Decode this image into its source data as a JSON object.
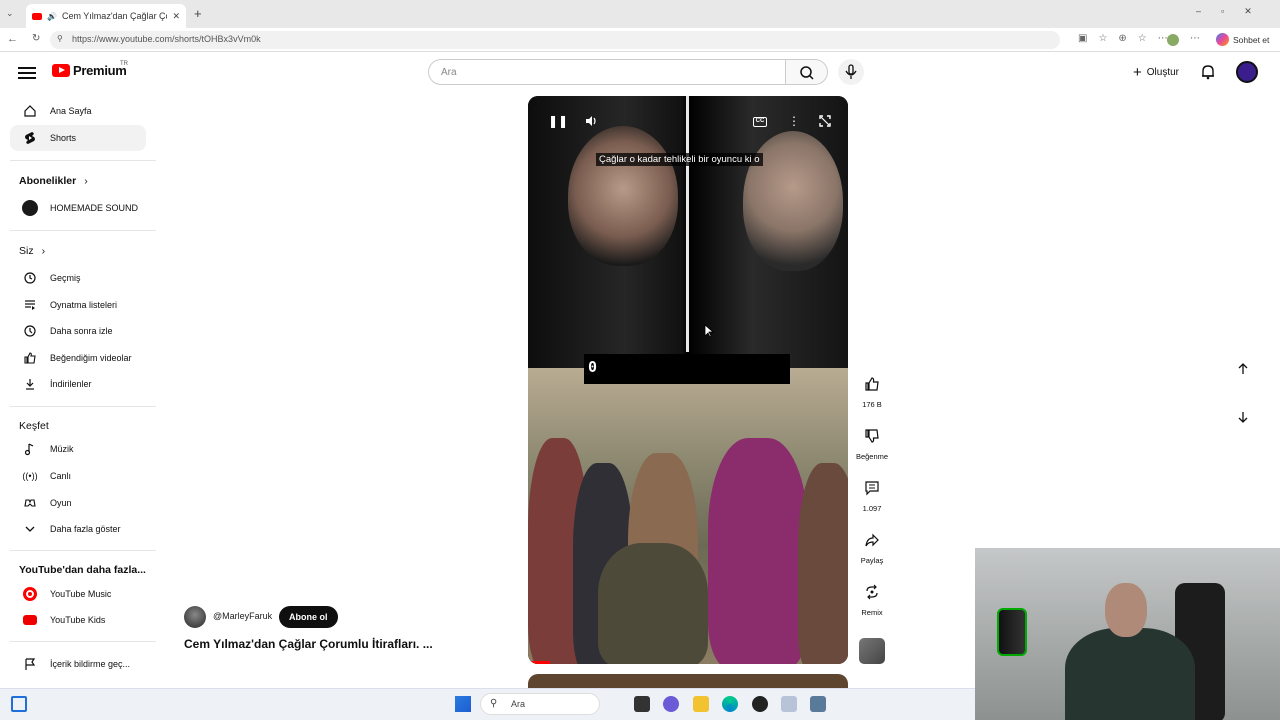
{
  "browser": {
    "tab_title": "Cem Yılmaz'dan Çağlar Çorumlu İtirafları",
    "new_tab_symbol": "+",
    "url": "https://www.youtube.com/shorts/tOHBx3vVm0k",
    "copilot_label": "Sohbet et"
  },
  "header": {
    "logo_text": "Premium",
    "logo_region": "TR",
    "search_placeholder": "Ara",
    "create_label": "Oluştur"
  },
  "sidebar": {
    "main": [
      {
        "label": "Ana Sayfa",
        "icon": "home-icon"
      },
      {
        "label": "Shorts",
        "icon": "shorts-icon",
        "active": true
      }
    ],
    "subscriptions_title": "Abonelikler",
    "subscriptions": [
      {
        "label": "HOMEMADE SOUND"
      }
    ],
    "you_title": "Siz",
    "you": [
      {
        "label": "Geçmiş",
        "icon": "history-icon"
      },
      {
        "label": "Oynatma listeleri",
        "icon": "playlist-icon"
      },
      {
        "label": "Daha sonra izle",
        "icon": "clock-icon"
      },
      {
        "label": "Beğendiğim videolar",
        "icon": "like-icon"
      },
      {
        "label": "İndirilenler",
        "icon": "download-icon"
      }
    ],
    "explore_title": "Keşfet",
    "explore": [
      {
        "label": "Müzik",
        "icon": "music-icon"
      },
      {
        "label": "Canlı",
        "icon": "live-icon"
      },
      {
        "label": "Oyun",
        "icon": "gaming-icon"
      },
      {
        "label": "Daha fazla göster",
        "icon": "chevron-down-icon"
      }
    ],
    "more_title": "YouTube'dan daha fazla...",
    "more": [
      {
        "label": "YouTube Music",
        "icon": "youtube-music-icon"
      },
      {
        "label": "YouTube Kids",
        "icon": "youtube-kids-icon"
      }
    ],
    "report_label": "İçerik bildirme geç..."
  },
  "video": {
    "subtitle": "Çağlar o kadar tehlikeli bir oyuncu ki o",
    "counter": "0",
    "progress_fraction": 0.07,
    "cc_label": "CC"
  },
  "channel": {
    "handle": "@MarleyFaruk",
    "subscribe_label": "Abone ol"
  },
  "video_title": "Cem Yılmaz'dan Çağlar Çorumlu İtirafları. ...",
  "actions": {
    "likes": "176 B",
    "dislike_label": "Beğenme",
    "comments": "1.097",
    "share_label": "Paylaş",
    "remix_label": "Remix"
  },
  "taskbar": {
    "search_label": "Ara"
  },
  "colors": {
    "youtube_red": "#ff0000",
    "subscribe_bg": "#0f0f0f"
  }
}
